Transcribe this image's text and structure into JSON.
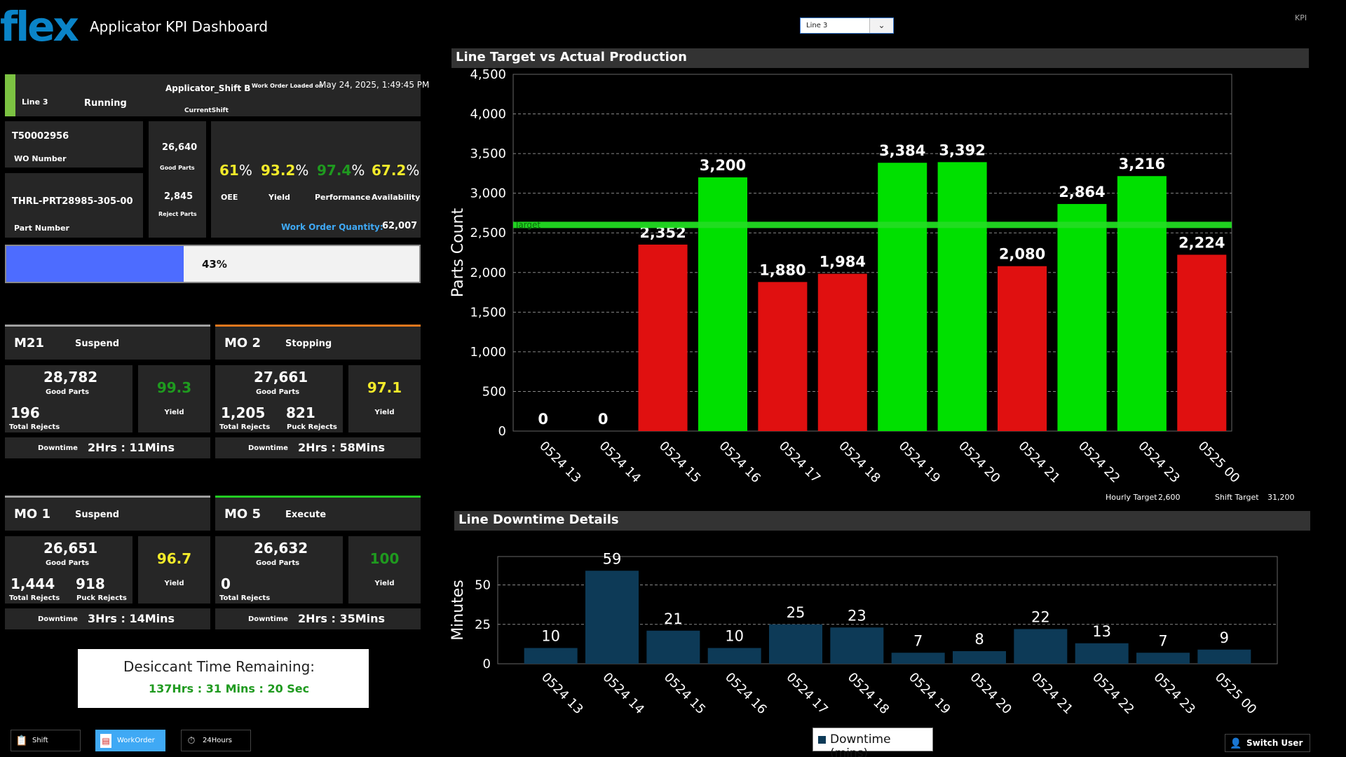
{
  "header": {
    "logo": "flex",
    "title": "Applicator KPI  Dashboard",
    "line_select": "Line 3",
    "kpi_tag": "KPI"
  },
  "status_bar": {
    "line": "Line  3",
    "state": "Running",
    "shift": "Applicator_Shift B",
    "shift_label": "CurrentShift",
    "wo_loaded_label": "Work Order Loaded on",
    "wo_loaded_time": "May 24, 2025, 1:49:45 PM",
    "accent_color": "#7cc242"
  },
  "work_order": {
    "number": "T50002956",
    "number_label": "WO Number",
    "part_number": "THRL-PRT28985-305-00",
    "part_label": "Part Number",
    "good_parts": "26,640",
    "good_parts_label": "Good Parts",
    "reject_parts": "2,845",
    "reject_parts_label": "Reject Parts",
    "oee": "61",
    "oee_label": "OEE",
    "yield": "93.2",
    "yield_label": "Yield",
    "performance": "97.4",
    "performance_label": "Performance",
    "availability": "67.2",
    "availability_label": "Availability",
    "percent_sign": "%",
    "qty_label": "Work Order Quantity:",
    "qty": "62,007",
    "progress_text": "43%",
    "progress_fraction": 0.43
  },
  "machines": [
    {
      "name": "M21",
      "status": "Suspend",
      "good": "28,782",
      "good_label": "Good Parts",
      "total_rejects": "196",
      "total_rejects_label": "Total Rejects",
      "puck_rejects": "",
      "puck_rejects_label": "",
      "yield": "99.3",
      "yield_label": "Yield",
      "yield_color": "#1f9a1f",
      "downtime_label": "Downtime",
      "downtime": "2Hrs : 11Mins",
      "bar_color": "#a0a0a0"
    },
    {
      "name": "MO 2",
      "status": "Stopping",
      "good": "27,661",
      "good_label": "Good Parts",
      "total_rejects": "1,205",
      "total_rejects_label": "Total Rejects",
      "puck_rejects": "821",
      "puck_rejects_label": "Puck Rejects",
      "yield": "97.1",
      "yield_label": "Yield",
      "yield_color": "#f2ea2a",
      "downtime_label": "Downtime",
      "downtime": "2Hrs : 58Mins",
      "bar_color": "#e8781e"
    },
    {
      "name": "MO 1",
      "status": "Suspend",
      "good": "26,651",
      "good_label": "Good Parts",
      "total_rejects": "1,444",
      "total_rejects_label": "Total Rejects",
      "puck_rejects": "918",
      "puck_rejects_label": "Puck Rejects",
      "yield": "96.7",
      "yield_label": "Yield",
      "yield_color": "#f2ea2a",
      "downtime_label": "Downtime",
      "downtime": "3Hrs : 14Mins",
      "bar_color": "#a0a0a0"
    },
    {
      "name": "MO 5",
      "status": "Execute",
      "good": "26,632",
      "good_label": "Good Parts",
      "total_rejects": "0",
      "total_rejects_label": "Total Rejects",
      "puck_rejects": "",
      "puck_rejects_label": "",
      "yield": "100",
      "yield_label": "Yield",
      "yield_color": "#1f9a1f",
      "downtime_label": "Downtime",
      "downtime": "2Hrs : 35Mins",
      "bar_color": "#22cc22"
    }
  ],
  "desiccant": {
    "title": "Desiccant Time Remaining:",
    "value": "137Hrs : 31 Mins : 20 Sec"
  },
  "bottom_tabs": [
    {
      "label": "Shift",
      "icon": "clipboard-icon",
      "active": false
    },
    {
      "label": "WorkOrder",
      "icon": "document-icon",
      "active": true
    },
    {
      "label": "24Hours",
      "icon": "stopwatch-icon",
      "active": false
    }
  ],
  "switch_user": "Switch User",
  "targets": {
    "hourly_label": "Hourly Target",
    "hourly": "2,600",
    "shift_label": "Shift Target",
    "shift": "31,200"
  },
  "chart_data": [
    {
      "type": "bar",
      "title": "Line Target vs  Actual Production",
      "ylabel": "Parts Count",
      "xlabel": "",
      "categories": [
        "0524 13",
        "0524 14",
        "0524 15",
        "0524 16",
        "0524 17",
        "0524 18",
        "0524 19",
        "0524 20",
        "0524 21",
        "0524 22",
        "0524 23",
        "0525 00"
      ],
      "values": [
        0,
        0,
        2352,
        3200,
        1880,
        1984,
        3384,
        3392,
        2080,
        2864,
        3216,
        2224
      ],
      "value_labels": [
        "0",
        "0",
        "2,352",
        "3,200",
        "1,880",
        "1,984",
        "3,384",
        "3,392",
        "2,080",
        "2,864",
        "3,216",
        "2,224"
      ],
      "ylim": [
        0,
        4500
      ],
      "yticks": [
        "0",
        "500",
        "1,000",
        "1,500",
        "2,000",
        "2,500",
        "3,000",
        "3,500",
        "4,000",
        "4,500"
      ],
      "target": 2600,
      "target_label": "Target",
      "above_color": "#00e000",
      "below_color": "#e01010",
      "target_color": "#22dd22",
      "grid": true
    },
    {
      "type": "bar",
      "title": "Line Downtime Details",
      "ylabel": "Minutes",
      "xlabel": "",
      "categories": [
        "0524 13",
        "0524 14",
        "0524 15",
        "0524 16",
        "0524 17",
        "0524 18",
        "0524 19",
        "0524 20",
        "0524 21",
        "0524 22",
        "0524 23",
        "0525 00"
      ],
      "values": [
        10,
        59,
        21,
        10,
        25,
        23,
        7,
        8,
        22,
        13,
        7,
        9
      ],
      "ylim": [
        0,
        68
      ],
      "yticks": [
        "0",
        "25",
        "50"
      ],
      "series_name": "Downtime (mins)",
      "bar_color": "#0d3a57",
      "grid": true,
      "legend": "bottom-center"
    }
  ]
}
